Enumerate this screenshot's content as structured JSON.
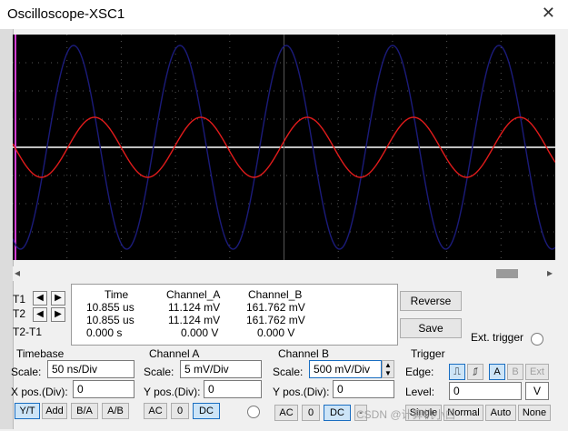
{
  "window": {
    "title": "Oscilloscope-XSC1",
    "close": "✕"
  },
  "readout": {
    "rows": [
      {
        "label": "T1",
        "time": "10.855 us",
        "a": "11.124 mV",
        "b": "161.762 mV"
      },
      {
        "label": "T2",
        "time": "10.855 us",
        "a": "11.124 mV",
        "b": "161.762 mV"
      },
      {
        "label": "T2-T1",
        "time": "0.000 s",
        "a": "0.000 V",
        "b": "0.000 V"
      }
    ],
    "headers": {
      "time": "Time",
      "a": "Channel_A",
      "b": "Channel_B"
    }
  },
  "buttons": {
    "reverse": "Reverse",
    "save": "Save",
    "ext_trigger": "Ext. trigger"
  },
  "timebase": {
    "title": "Timebase",
    "scale_label": "Scale:",
    "scale_value": "50 ns/Div",
    "xpos_label": "X pos.(Div):",
    "xpos_value": "0",
    "modes": [
      "Y/T",
      "Add",
      "B/A",
      "A/B"
    ]
  },
  "channel_a": {
    "title": "Channel A",
    "scale_label": "Scale:",
    "scale_value": "5 mV/Div",
    "ypos_label": "Y pos.(Div):",
    "ypos_value": "0",
    "coupling": [
      "AC",
      "0",
      "DC"
    ]
  },
  "channel_b": {
    "title": "Channel B",
    "scale_label": "Scale:",
    "scale_value": "500 mV/Div",
    "ypos_label": "Y pos.(Div):",
    "ypos_value": "0",
    "coupling": [
      "AC",
      "0",
      "DC",
      "-"
    ]
  },
  "trigger": {
    "title": "Trigger",
    "edge_label": "Edge:",
    "level_label": "Level:",
    "level_value": "0",
    "level_unit": "V",
    "edge_buttons": [
      "A",
      "B",
      "Ext"
    ],
    "modes": [
      "Single",
      "Normal",
      "Auto",
      "None"
    ]
  },
  "watermark": "CSDN @计算机小白",
  "colors": {
    "channel_a": "#e11b1b",
    "channel_b": "#1b1b7a",
    "screen": "#000000",
    "grid": "#555555",
    "axis": "#ffffff"
  }
}
